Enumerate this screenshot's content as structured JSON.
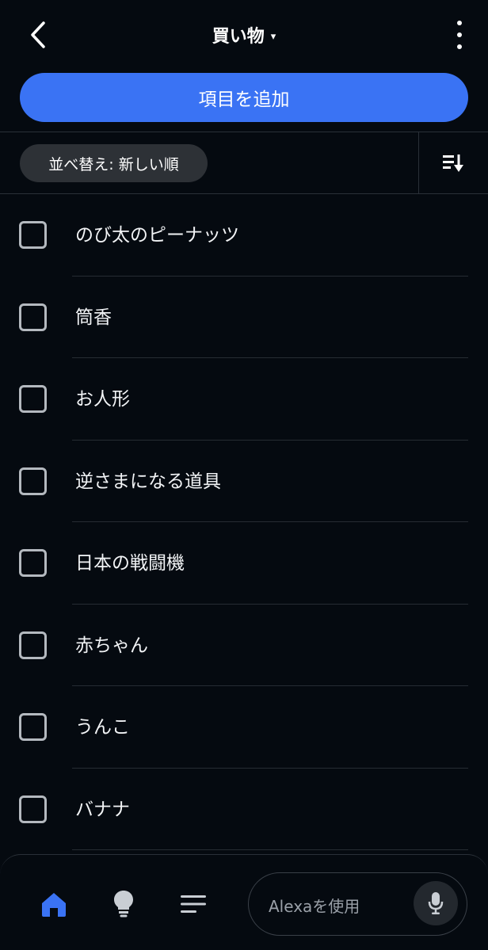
{
  "header": {
    "title": "買い物",
    "title_caret": "▾",
    "back_icon": "chevron-left-icon",
    "more_icon": "more-vertical-icon"
  },
  "add_button": {
    "label": "項目を追加",
    "color": "#3a73f4"
  },
  "sort": {
    "chip_label": "並べ替え: 新しい順",
    "toggle_icon": "sort-descending-icon"
  },
  "items": [
    {
      "label": "のび太のピーナッツ",
      "checked": false
    },
    {
      "label": "筒香",
      "checked": false
    },
    {
      "label": "お人形",
      "checked": false
    },
    {
      "label": "逆さまになる道具",
      "checked": false
    },
    {
      "label": "日本の戦闘機",
      "checked": false
    },
    {
      "label": "赤ちゃん",
      "checked": false
    },
    {
      "label": "うんこ",
      "checked": false
    },
    {
      "label": "バナナ",
      "checked": false
    }
  ],
  "bottom_nav": {
    "items": [
      {
        "icon": "home-icon",
        "active": true
      },
      {
        "icon": "lightbulb-icon",
        "active": false
      },
      {
        "icon": "list-icon",
        "active": false
      }
    ],
    "alexa_placeholder": "Alexaを使用",
    "mic_icon": "microphone-icon",
    "active_color": "#3a73f4"
  }
}
